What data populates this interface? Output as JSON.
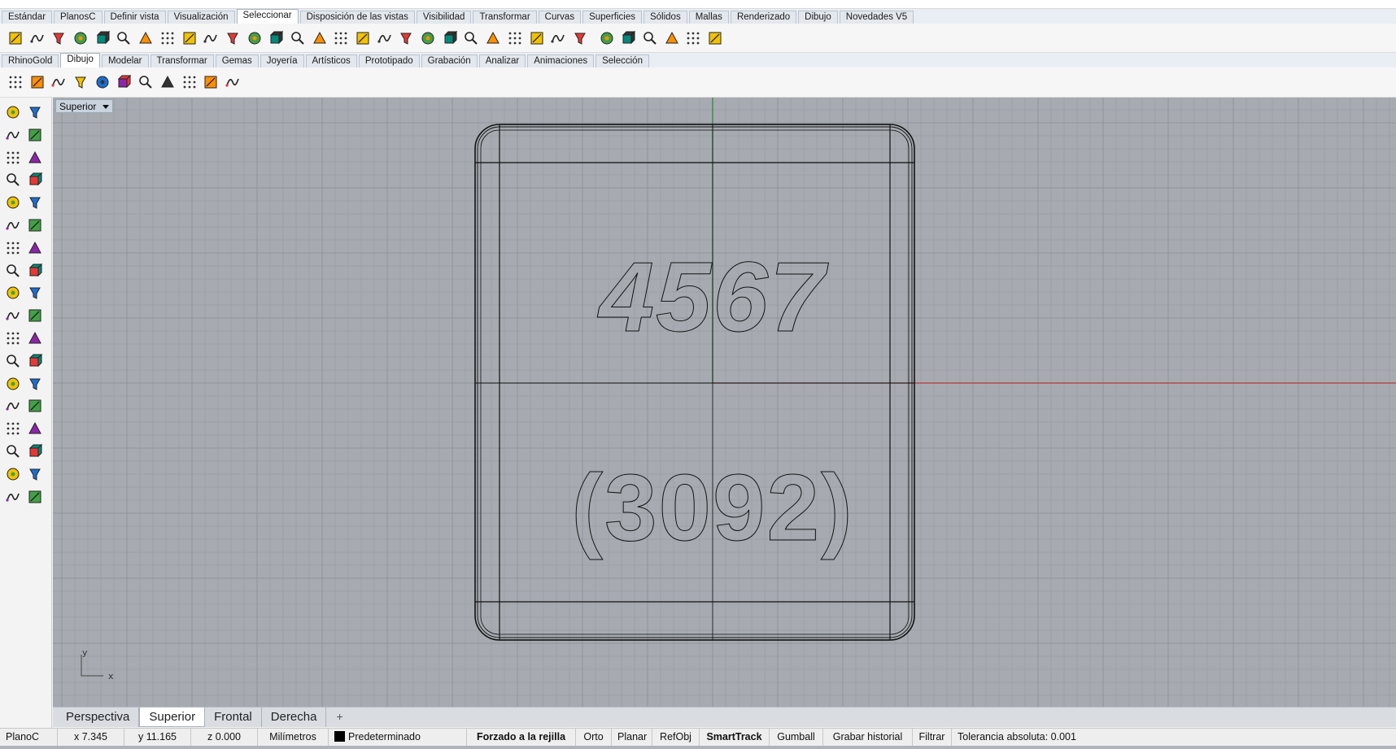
{
  "ribbon_tabs_row1": [
    {
      "label": "Estándar",
      "active": false
    },
    {
      "label": "PlanosC",
      "active": false
    },
    {
      "label": "Definir vista",
      "active": false
    },
    {
      "label": "Visualización",
      "active": false
    },
    {
      "label": "Seleccionar",
      "active": true
    },
    {
      "label": "Disposición de las vistas",
      "active": false
    },
    {
      "label": "Visibilidad",
      "active": false
    },
    {
      "label": "Transformar",
      "active": false
    },
    {
      "label": "Curvas",
      "active": false
    },
    {
      "label": "Superficies",
      "active": false
    },
    {
      "label": "Sólidos",
      "active": false
    },
    {
      "label": "Mallas",
      "active": false
    },
    {
      "label": "Renderizado",
      "active": false
    },
    {
      "label": "Dibujo",
      "active": false
    },
    {
      "label": "Novedades V5",
      "active": false
    }
  ],
  "ribbon_tabs_row2": [
    {
      "label": "RhinoGold",
      "active": false
    },
    {
      "label": "Dibujo",
      "active": true
    },
    {
      "label": "Modelar",
      "active": false
    },
    {
      "label": "Transformar",
      "active": false
    },
    {
      "label": "Gemas",
      "active": false
    },
    {
      "label": "Joyería",
      "active": false
    },
    {
      "label": "Artísticos",
      "active": false
    },
    {
      "label": "Prototipado",
      "active": false
    },
    {
      "label": "Grabación",
      "active": false
    },
    {
      "label": "Analizar",
      "active": false
    },
    {
      "label": "Animaciones",
      "active": false
    },
    {
      "label": "Selección",
      "active": false
    }
  ],
  "toolbar1_icons": [
    "select-points-icon",
    "select-control-points-icon",
    "select-surfaces-icon",
    "select-polysurfaces-icon",
    "select-curves-icon",
    "select-lights-icon",
    "select-annotations-icon",
    "select-blocks-icon",
    "select-color-icon",
    "select-meshes-icon",
    "select-point-clouds-icon",
    "select-points-cloud-icon",
    "select-extrusions-icon",
    "select-lines-icon",
    "select-hatches-icon",
    "select-dims-icon",
    "select-text-icon",
    "select-groups-icon",
    "select-render-icon",
    "select-open-icon",
    "select-closed-icon",
    "select-planar-icon",
    "select-crv-icon",
    "select-layer-icon",
    "select-sub-icon",
    "select-dup-icon",
    "select-small-icon",
    "select-big-icon",
    "select-bad-icon",
    "select-sweep-icon",
    "select-brush-icon",
    "zoom-select-icon",
    "filter-icon"
  ],
  "toolbar2_icons": [
    "points-icon",
    "curve-icon",
    "pattern-icon",
    "circle-spiral-icon",
    "molecule-icon",
    "rings-icon",
    "text-abc-icon",
    "clip-icon",
    "link-icon",
    "gear-sparkle-icon",
    "star-icon"
  ],
  "left_tools": [
    "select-arrow-icon",
    "point-icon",
    "polyline-icon",
    "curve-cp-icon",
    "circle-icon",
    "ellipse-icon",
    "arc-icon",
    "rectangle-icon",
    "polygon-icon",
    "fillet-curve-icon",
    "surface-patch-icon",
    "sweep-icon",
    "box-solid-icon",
    "boolean-icon",
    "extrude-icon",
    "plane-surface-icon",
    "gear-wrench-icon",
    "explode-icon",
    "split-icon",
    "trim-icon",
    "move-icon",
    "copy-icon",
    "rotate-icon",
    "scale-icon",
    "text-object-icon",
    "scale-2d-icon",
    "array-icon",
    "mirror-icon",
    "extract-icon",
    "dimension-icon",
    "group-icon",
    "ungroup-icon",
    "cut-icon",
    "check-icon",
    "render-cube-icon",
    "shade-icon"
  ],
  "viewport": {
    "label": "Superior",
    "axis_y": "y",
    "axis_x": "x",
    "engraving_top": "4567",
    "engraving_bottom": "(3092)"
  },
  "view_tabs": [
    {
      "label": "Perspectiva",
      "active": false
    },
    {
      "label": "Superior",
      "active": true
    },
    {
      "label": "Frontal",
      "active": false
    },
    {
      "label": "Derecha",
      "active": false
    }
  ],
  "view_tab_add": "+",
  "status": {
    "cplane": "PlanoC",
    "x": "x 7.345",
    "y": "y 11.165",
    "z": "z 0.000",
    "units": "Milímetros",
    "layer": "Predeterminado",
    "grid_snap": "Forzado a la rejilla",
    "ortho": "Orto",
    "planar": "Planar",
    "osnap": "RefObj",
    "smarttrack": "SmartTrack",
    "gumball": "Gumball",
    "history": "Grabar historial",
    "filter": "Filtrar",
    "tolerance": "Tolerancia absoluta: 0.001"
  },
  "colors": {
    "viewport_bg": "#a7abb1",
    "grid_minor": "#9ba0a6",
    "grid_major": "#8f949a",
    "axis_x": "#b23a3a",
    "axis_y": "#2a8a3a",
    "geometry": "#111111"
  }
}
